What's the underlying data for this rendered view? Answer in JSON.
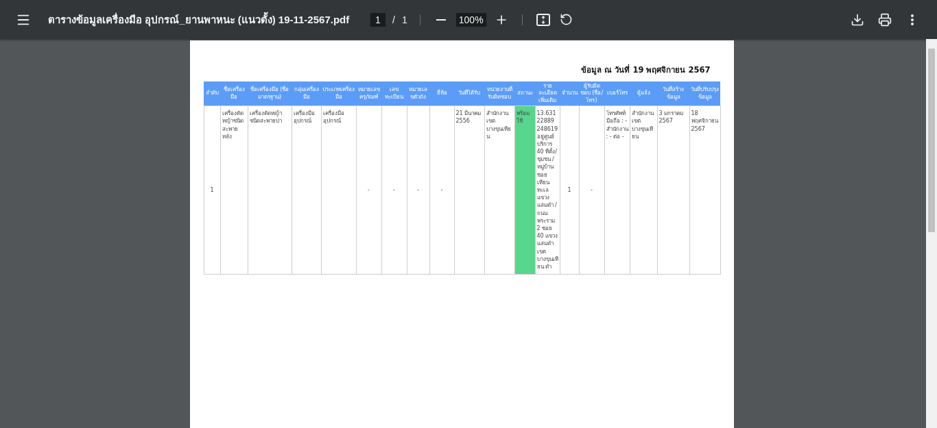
{
  "toolbar": {
    "title": "ตารางข้อมูลเครื่องมือ อุปกรณ์_ยานพาหนะ (แนวตั้ง) 19-11-2567.pdf",
    "page_input": "1",
    "page_separator": "/",
    "page_total": "1",
    "zoom": "100%"
  },
  "document": {
    "heading": "ข้อมูล ณ วันที่ 19 พฤศจิกายน 2567",
    "columns": [
      "ลำดับ",
      "ชื่อเครื่องมือ",
      "ชื่อเครื่องมือ (ชื่อมาตรฐาน)",
      "กลุ่มเครื่องมือ",
      "ประเภทเครื่องมือ",
      "หมายเลขครุภัณฑ์",
      "เลขทะเบียน",
      "หมายเลขตัวถัง",
      "ยี่ห้อ",
      "วันที่ได้รับ",
      "หน่วยงานที่รับผิดชอบ",
      "สถานะ",
      "รายละเอียดเพิ่มเติม",
      "จำนวน",
      "ผู้รับผิดชอบ (ชื่อ/โทร)",
      "เบอร์โทร",
      "ผู้แจ้ง",
      "วันที่สร้างข้อมูล",
      "วันที่ปรับปรุงข้อมูล"
    ],
    "rows": [
      {
        "cells": [
          {
            "kind": "text",
            "text": "1"
          },
          {
            "kind": "text",
            "text": "เครื่องตัดหญ้าชนิดสะพายหลัง"
          },
          {
            "kind": "text",
            "text": "เครื่องตัดหญ้าชนิดสะพายบ่า"
          },
          {
            "kind": "text",
            "text": "เครื่องมืออุปกรณ์"
          },
          {
            "kind": "text",
            "text": "เครื่องมืออุปกรณ์"
          },
          {
            "kind": "empty",
            "text": "-"
          },
          {
            "kind": "empty",
            "text": "-"
          },
          {
            "kind": "empty",
            "text": "-"
          },
          {
            "kind": "empty",
            "text": "-"
          },
          {
            "kind": "text",
            "text": "21 มีนาคม 2556"
          },
          {
            "kind": "text",
            "text": "สำนักงานเขตบางขุนเทียน"
          },
          {
            "kind": "status",
            "text": "พร้อมใช้"
          },
          {
            "kind": "text",
            "text": "13.63122889 248619 อยู่ศูนย์บริการ 40 ที่ตั้ง/ชุมชน /หมู่บ้าน ซอยเทียนทะเล แขวงแสมดำ /ถนนพระราม 2 ซอย 40 แขวงแสมดำ เขตบางขุนเทียน ดำ"
          },
          {
            "kind": "text",
            "text": "1"
          },
          {
            "kind": "empty",
            "text": "-"
          },
          {
            "kind": "text",
            "text": "โทรศัพท์มือถือ : - สำนักงาน : - ต่อ -"
          },
          {
            "kind": "text",
            "text": "สำนักงานเขตบางขุนเทียน"
          },
          {
            "kind": "text",
            "text": "3 มกราคม 2567"
          },
          {
            "kind": "text",
            "text": "18 พฤศจิกายน 2567"
          }
        ]
      }
    ]
  }
}
